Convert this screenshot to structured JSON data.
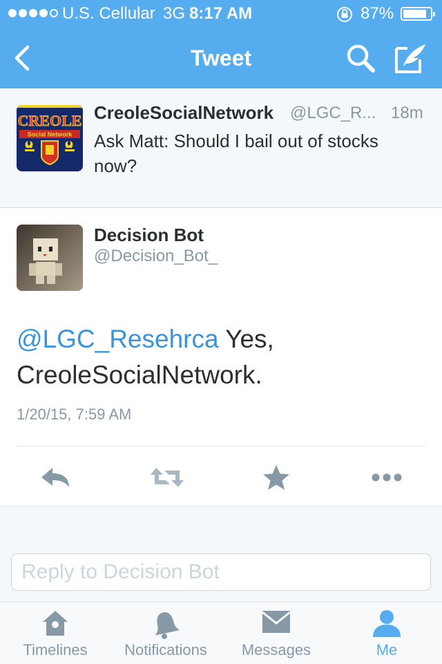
{
  "status_bar": {
    "carrier": "U.S. Cellular",
    "network": "3G",
    "time": "8:17 AM",
    "battery": "87%",
    "battery_level": 0.87
  },
  "nav": {
    "title": "Tweet",
    "icons": [
      "back-chevron-icon",
      "search-icon",
      "compose-icon"
    ]
  },
  "parent_tweet": {
    "name": "CreoleSocialNetwork",
    "handle": "@LGC_R...",
    "time": "18m",
    "text": "Ask Matt: Should I bail out of stocks now?",
    "avatar": {
      "title": "CREOLE",
      "subtitle": "Social Network"
    }
  },
  "focused_tweet": {
    "name": "Decision Bot",
    "handle": "@Decision_Bot_",
    "mention": "@LGC_Resehrca",
    "text": " Yes, CreoleSocialNetwork.",
    "date": "1/20/15, 7:59 AM",
    "actions": [
      "reply-icon",
      "retweet-icon",
      "favorite-icon",
      "more-icon"
    ]
  },
  "reply": {
    "placeholder": "Reply to Decision Bot"
  },
  "tabs": [
    {
      "label": "Timelines",
      "icon": "home-icon",
      "active": false
    },
    {
      "label": "Notifications",
      "icon": "bell-icon",
      "active": false
    },
    {
      "label": "Messages",
      "icon": "envelope-icon",
      "active": false
    },
    {
      "label": "Me",
      "icon": "person-icon",
      "active": true
    }
  ],
  "colors": {
    "brand": "#55acee",
    "link": "#3b94d9",
    "muted": "#8899a6",
    "action_icon": "#aab8c2",
    "action_icon_dark": "#8899a6"
  }
}
